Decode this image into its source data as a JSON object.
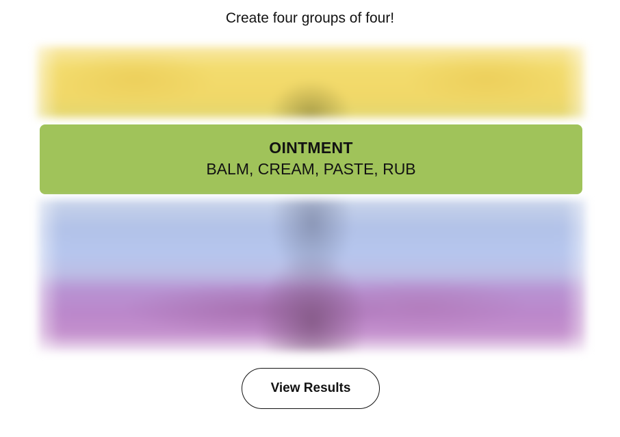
{
  "game": {
    "instructions": "Create four groups of four!"
  },
  "board": {
    "hidden_rows": [
      {
        "color_name": "yellow",
        "color": "#f3dc6e"
      },
      {
        "color_name": "blue",
        "color": "#b2c2e8"
      },
      {
        "color_name": "purple",
        "color": "#bb87cb"
      }
    ],
    "solved_groups": [
      {
        "title": "OINTMENT",
        "members": "BALM, CREAM, PASTE, RUB",
        "color": "#a0c35a"
      }
    ]
  },
  "actions": {
    "view_results_label": "View Results"
  }
}
